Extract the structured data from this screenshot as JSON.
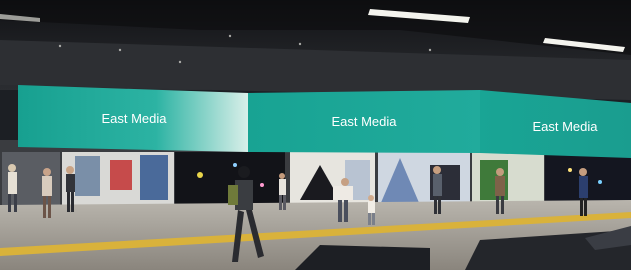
{
  "scene": {
    "signage": [
      {
        "label": "East Media"
      },
      {
        "label": "East Media"
      },
      {
        "label": "East Media"
      }
    ],
    "colors": {
      "banner": "#1fa89a",
      "banner_highlight": "#3fc1b3",
      "ceiling": "#1f2125",
      "floor": "#9c9891",
      "tactile_strip": "#d8b23a",
      "ceiling_light": "#f2f2ea"
    }
  }
}
